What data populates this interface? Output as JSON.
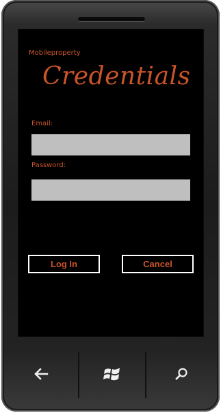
{
  "app": {
    "name": "Mobileproperty",
    "page_title": "Credentials"
  },
  "form": {
    "email_label": "Email:",
    "email_value": "",
    "password_label": "Password:",
    "password_value": ""
  },
  "actions": {
    "login_label": "Log In",
    "cancel_label": "Cancel"
  },
  "hardware_buttons": {
    "back_icon": "back-arrow-icon",
    "start_icon": "windows-logo-icon",
    "search_icon": "search-icon"
  },
  "colors": {
    "accent": "#c9542a",
    "screen_background": "#000000",
    "field_background": "#bfbfbf",
    "button_border": "#ffffff"
  }
}
